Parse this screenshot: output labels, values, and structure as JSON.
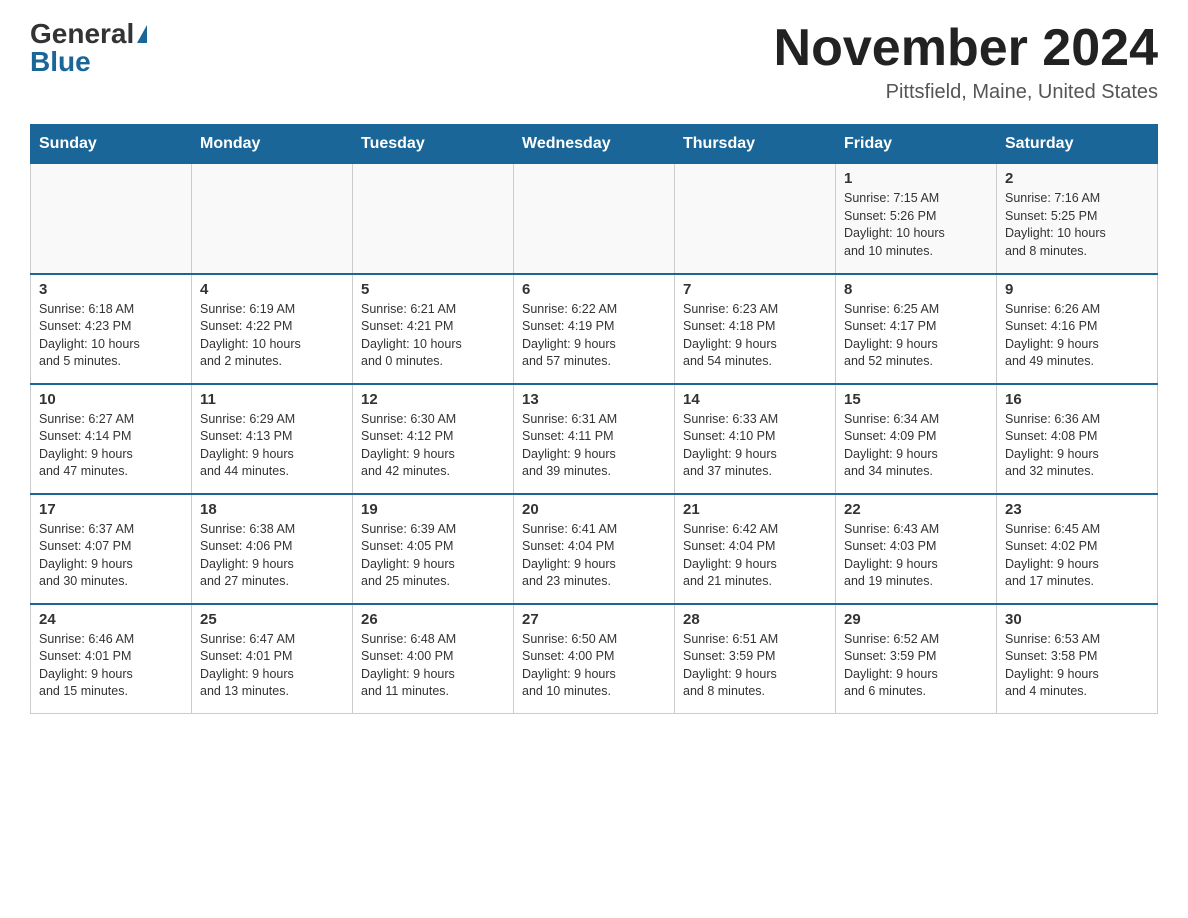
{
  "header": {
    "logo_general": "General",
    "logo_blue": "Blue",
    "month_title": "November 2024",
    "location": "Pittsfield, Maine, United States"
  },
  "weekdays": [
    "Sunday",
    "Monday",
    "Tuesday",
    "Wednesday",
    "Thursday",
    "Friday",
    "Saturday"
  ],
  "weeks": [
    [
      {
        "day": "",
        "info": ""
      },
      {
        "day": "",
        "info": ""
      },
      {
        "day": "",
        "info": ""
      },
      {
        "day": "",
        "info": ""
      },
      {
        "day": "",
        "info": ""
      },
      {
        "day": "1",
        "info": "Sunrise: 7:15 AM\nSunset: 5:26 PM\nDaylight: 10 hours\nand 10 minutes."
      },
      {
        "day": "2",
        "info": "Sunrise: 7:16 AM\nSunset: 5:25 PM\nDaylight: 10 hours\nand 8 minutes."
      }
    ],
    [
      {
        "day": "3",
        "info": "Sunrise: 6:18 AM\nSunset: 4:23 PM\nDaylight: 10 hours\nand 5 minutes."
      },
      {
        "day": "4",
        "info": "Sunrise: 6:19 AM\nSunset: 4:22 PM\nDaylight: 10 hours\nand 2 minutes."
      },
      {
        "day": "5",
        "info": "Sunrise: 6:21 AM\nSunset: 4:21 PM\nDaylight: 10 hours\nand 0 minutes."
      },
      {
        "day": "6",
        "info": "Sunrise: 6:22 AM\nSunset: 4:19 PM\nDaylight: 9 hours\nand 57 minutes."
      },
      {
        "day": "7",
        "info": "Sunrise: 6:23 AM\nSunset: 4:18 PM\nDaylight: 9 hours\nand 54 minutes."
      },
      {
        "day": "8",
        "info": "Sunrise: 6:25 AM\nSunset: 4:17 PM\nDaylight: 9 hours\nand 52 minutes."
      },
      {
        "day": "9",
        "info": "Sunrise: 6:26 AM\nSunset: 4:16 PM\nDaylight: 9 hours\nand 49 minutes."
      }
    ],
    [
      {
        "day": "10",
        "info": "Sunrise: 6:27 AM\nSunset: 4:14 PM\nDaylight: 9 hours\nand 47 minutes."
      },
      {
        "day": "11",
        "info": "Sunrise: 6:29 AM\nSunset: 4:13 PM\nDaylight: 9 hours\nand 44 minutes."
      },
      {
        "day": "12",
        "info": "Sunrise: 6:30 AM\nSunset: 4:12 PM\nDaylight: 9 hours\nand 42 minutes."
      },
      {
        "day": "13",
        "info": "Sunrise: 6:31 AM\nSunset: 4:11 PM\nDaylight: 9 hours\nand 39 minutes."
      },
      {
        "day": "14",
        "info": "Sunrise: 6:33 AM\nSunset: 4:10 PM\nDaylight: 9 hours\nand 37 minutes."
      },
      {
        "day": "15",
        "info": "Sunrise: 6:34 AM\nSunset: 4:09 PM\nDaylight: 9 hours\nand 34 minutes."
      },
      {
        "day": "16",
        "info": "Sunrise: 6:36 AM\nSunset: 4:08 PM\nDaylight: 9 hours\nand 32 minutes."
      }
    ],
    [
      {
        "day": "17",
        "info": "Sunrise: 6:37 AM\nSunset: 4:07 PM\nDaylight: 9 hours\nand 30 minutes."
      },
      {
        "day": "18",
        "info": "Sunrise: 6:38 AM\nSunset: 4:06 PM\nDaylight: 9 hours\nand 27 minutes."
      },
      {
        "day": "19",
        "info": "Sunrise: 6:39 AM\nSunset: 4:05 PM\nDaylight: 9 hours\nand 25 minutes."
      },
      {
        "day": "20",
        "info": "Sunrise: 6:41 AM\nSunset: 4:04 PM\nDaylight: 9 hours\nand 23 minutes."
      },
      {
        "day": "21",
        "info": "Sunrise: 6:42 AM\nSunset: 4:04 PM\nDaylight: 9 hours\nand 21 minutes."
      },
      {
        "day": "22",
        "info": "Sunrise: 6:43 AM\nSunset: 4:03 PM\nDaylight: 9 hours\nand 19 minutes."
      },
      {
        "day": "23",
        "info": "Sunrise: 6:45 AM\nSunset: 4:02 PM\nDaylight: 9 hours\nand 17 minutes."
      }
    ],
    [
      {
        "day": "24",
        "info": "Sunrise: 6:46 AM\nSunset: 4:01 PM\nDaylight: 9 hours\nand 15 minutes."
      },
      {
        "day": "25",
        "info": "Sunrise: 6:47 AM\nSunset: 4:01 PM\nDaylight: 9 hours\nand 13 minutes."
      },
      {
        "day": "26",
        "info": "Sunrise: 6:48 AM\nSunset: 4:00 PM\nDaylight: 9 hours\nand 11 minutes."
      },
      {
        "day": "27",
        "info": "Sunrise: 6:50 AM\nSunset: 4:00 PM\nDaylight: 9 hours\nand 10 minutes."
      },
      {
        "day": "28",
        "info": "Sunrise: 6:51 AM\nSunset: 3:59 PM\nDaylight: 9 hours\nand 8 minutes."
      },
      {
        "day": "29",
        "info": "Sunrise: 6:52 AM\nSunset: 3:59 PM\nDaylight: 9 hours\nand 6 minutes."
      },
      {
        "day": "30",
        "info": "Sunrise: 6:53 AM\nSunset: 3:58 PM\nDaylight: 9 hours\nand 4 minutes."
      }
    ]
  ]
}
